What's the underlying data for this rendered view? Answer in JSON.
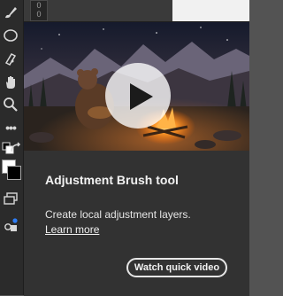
{
  "ruler": {
    "label": "0"
  },
  "toolbar": {
    "tools": [
      "brush-icon",
      "ellipse-icon",
      "spot-heal-icon",
      "hand-icon",
      "zoom-icon",
      "more-tools-icon",
      "default-colors-icon",
      "swap-colors-icon",
      "screen-mode-icon",
      "share-icon"
    ],
    "foreground_color": "#ffffff",
    "background_color": "#000000"
  },
  "popup": {
    "title": "Adjustment Brush tool",
    "description": "Create local adjustment layers.",
    "learn_more": "Learn more",
    "watch_button": "Watch quick video"
  }
}
